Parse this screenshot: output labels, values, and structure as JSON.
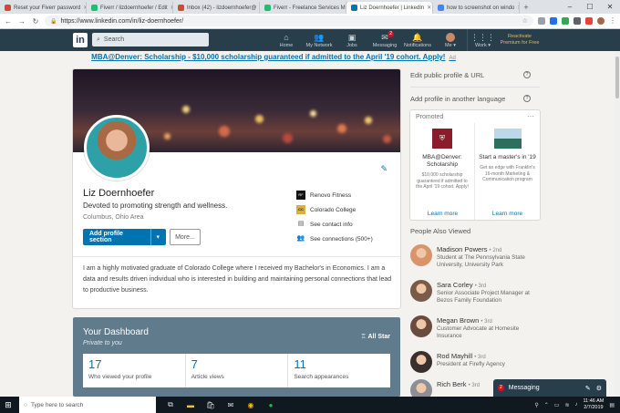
{
  "browser": {
    "tabs": [
      {
        "label": "Reset your Fiverr password",
        "color": "#d44638",
        "active": false
      },
      {
        "label": "Fiverr / lizdoernhoefer / Edit",
        "color": "#1dbf73",
        "active": false
      },
      {
        "label": "Inbox (42) - lizdoernhoefer@",
        "color": "#d44638",
        "active": false
      },
      {
        "label": "Fiverr - Freelance Services M",
        "color": "#1dbf73",
        "active": false
      },
      {
        "label": "Liz Doernhoefer | LinkedIn",
        "color": "#0073b1",
        "active": true
      },
      {
        "label": "how to screenshot on windo",
        "color": "#4285f4",
        "active": false
      }
    ],
    "url": "https://www.linkedin.com/in/liz-doernhoefer/"
  },
  "linkedin_nav": {
    "logo": "in",
    "search_placeholder": "Search",
    "items": [
      {
        "label": "Home",
        "icon": "home-icon",
        "glyph": "⌂"
      },
      {
        "label": "My Network",
        "icon": "network-icon",
        "glyph": "👥"
      },
      {
        "label": "Jobs",
        "icon": "briefcase-icon",
        "glyph": "▣"
      },
      {
        "label": "Messaging",
        "icon": "messaging-icon",
        "glyph": "✉",
        "badge": "2"
      },
      {
        "label": "Notifications",
        "icon": "bell-icon",
        "glyph": "🔔"
      },
      {
        "label": "Me ▾",
        "icon": "avatar",
        "glyph": ""
      }
    ],
    "work_label": "Work ▾",
    "premium_line1": "Reactivate",
    "premium_line2": "Premium for Free"
  },
  "ad": {
    "text": "MBA@Denver: Scholarship - $10,000 scholarship guaranteed if admitted to the April '19 cohort. Apply!",
    "tag": "Ad"
  },
  "profile": {
    "name": "Liz Doernhoefer",
    "headline": "Devoted to promoting strength and wellness.",
    "location": "Columbus, Ohio Area",
    "add_section_label": "Add profile section",
    "more_label": "More...",
    "side": [
      {
        "label": "Renovo Fitness",
        "icon": "renovo-logo"
      },
      {
        "label": "Colorado College",
        "icon": "colorado-college-logo"
      },
      {
        "label": "See contact info",
        "icon": "contact-card-icon"
      },
      {
        "label": "See connections (500+)",
        "icon": "connections-icon"
      }
    ],
    "summary": "I am a highly motivated graduate of Colorado College where I received my Bachelor's in Economics. I am a data and results driven individual who is interested in building and maintaining personal connections that lead to productive business."
  },
  "dashboard": {
    "title": "Your Dashboard",
    "subtitle": "Private to you",
    "all_star": "All Star",
    "stats": [
      {
        "value": "17",
        "label": "Who viewed your profile"
      },
      {
        "value": "7",
        "label": "Article views"
      },
      {
        "value": "11",
        "label": "Search appearances"
      }
    ]
  },
  "rail": {
    "edit_profile": "Edit public profile & URL",
    "add_language": "Add profile in another language",
    "promoted": {
      "header": "Promoted",
      "items": [
        {
          "title": "MBA@Denver: Scholarship",
          "desc": "$10,000 scholarship guaranteed if admitted to the April '19 cohort. Apply!",
          "link": "Learn more"
        },
        {
          "title": "Start a master's in '19",
          "desc": "Get an edge with Franklin's 16-month Marketing & Communication program",
          "link": "Learn more"
        }
      ]
    },
    "people_title": "People Also Viewed",
    "people": [
      {
        "name": "Madison Powers",
        "degree": "• 2nd",
        "desc": "Student at The Pennsylvania State University, University Park",
        "color": "#d9946a"
      },
      {
        "name": "Sara Corley",
        "degree": "• 3rd",
        "desc": "Senior Associate Project Manager at Bezos Family Foundation",
        "color": "#7a5a48"
      },
      {
        "name": "Megan Brown",
        "degree": "• 3rd",
        "desc": "Customer Advocate at Homesite Insurance",
        "color": "#6b4b3e"
      },
      {
        "name": "Rod Mayhill",
        "degree": "• 3rd",
        "desc": "President at Firefly Agency",
        "color": "#3a2f2c"
      },
      {
        "name": "Rich Berk",
        "degree": "• 3rd",
        "desc": "",
        "color": "#8c8f95"
      }
    ]
  },
  "messaging": {
    "label": "Messaging",
    "badge": "2"
  },
  "taskbar": {
    "search_placeholder": "Type here to search",
    "time": "11:46 AM",
    "date": "2/7/2019"
  }
}
